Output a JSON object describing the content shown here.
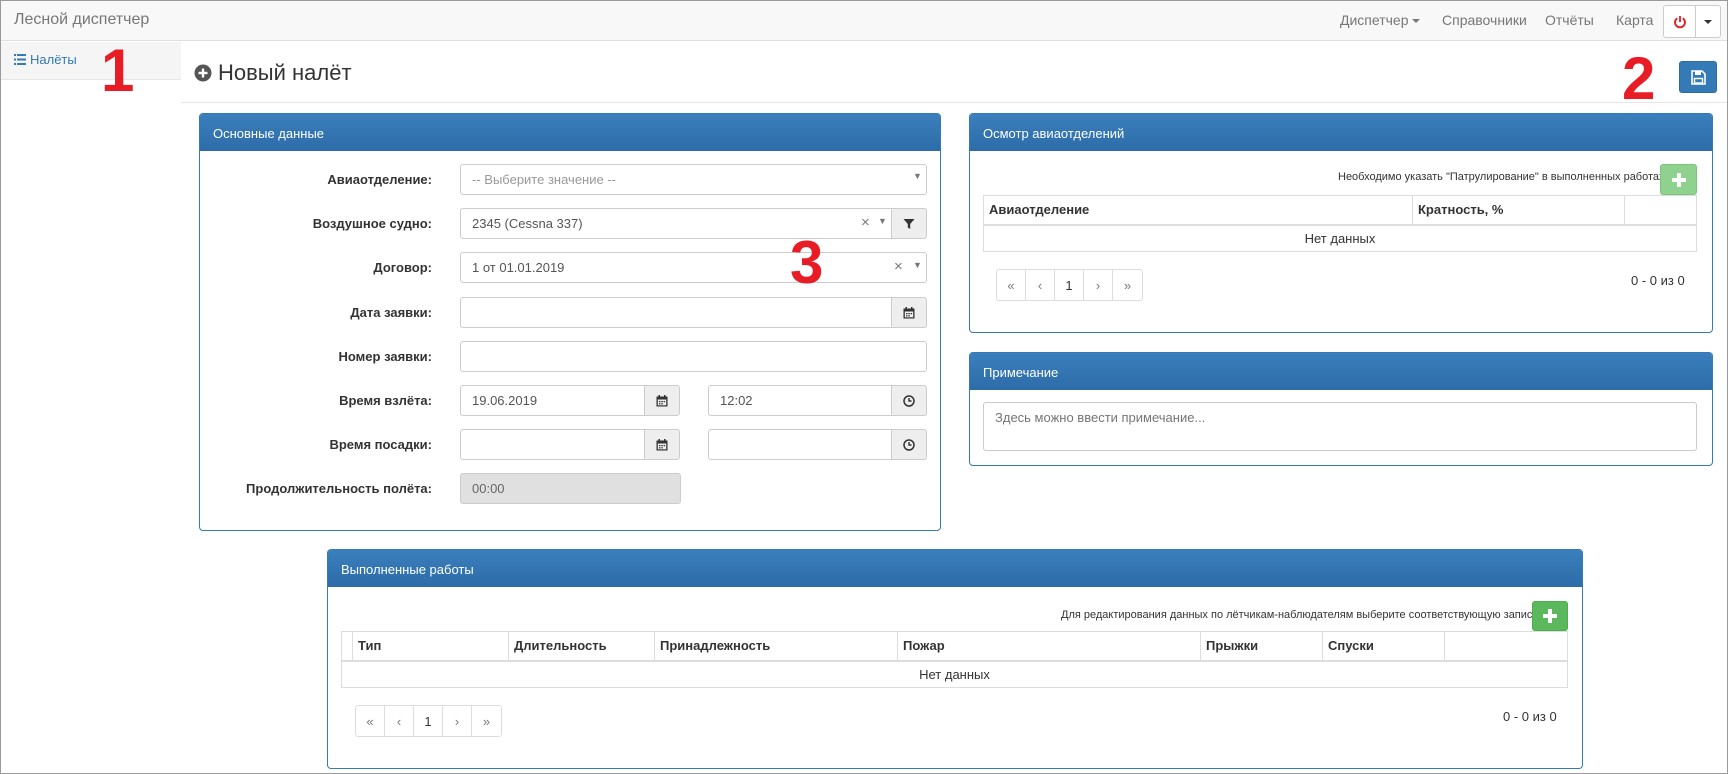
{
  "navbar": {
    "brand": "Лесной диспетчер",
    "items": [
      {
        "label": "Диспетчер"
      },
      {
        "label": "Справочники"
      },
      {
        "label": "Отчёты"
      },
      {
        "label": "Карта"
      }
    ]
  },
  "sidebar": {
    "items": [
      {
        "label": "Налёты"
      }
    ]
  },
  "page": {
    "title": "Новый налёт"
  },
  "annotations": [
    "1",
    "2",
    "3"
  ],
  "main_panel": {
    "title": "Основные данные",
    "fields": {
      "aviaotdelenie": {
        "label": "Авиаотделение:",
        "value": "-- Выберите значение --"
      },
      "aircraft": {
        "label": "Воздушное судно:",
        "value": "2345 (Cessna 337)"
      },
      "contract": {
        "label": "Договор:",
        "value": "1 от 01.01.2019"
      },
      "request_date": {
        "label": "Дата заявки:",
        "value": ""
      },
      "request_number": {
        "label": "Номер заявки:",
        "value": ""
      },
      "takeoff": {
        "label": "Время взлёта:",
        "date": "19.06.2019",
        "time": "12:02"
      },
      "landing": {
        "label": "Время посадки:",
        "date": "",
        "time": ""
      },
      "duration": {
        "label": "Продолжительность полёта:",
        "value": "00:00"
      }
    }
  },
  "inspection_panel": {
    "title": "Осмотр авиаотделений",
    "hint": "Необходимо указать \"Патрулирование\" в выполненных работах",
    "columns": [
      "Авиаотделение",
      "Кратность, %",
      ""
    ],
    "empty": "Нет данных",
    "pager": [
      "«",
      "‹",
      "1",
      "›",
      "»"
    ],
    "count": "0 - 0 из 0"
  },
  "note_panel": {
    "title": "Примечание",
    "placeholder": "Здесь можно ввести примечание..."
  },
  "works_panel": {
    "title": "Выполненные работы",
    "hint": "Для редактирования данных по лётчикам-наблюдателям выберите соответствующую запись.",
    "columns": [
      "",
      "Тип",
      "Длительность",
      "Принадлежность",
      "Пожар",
      "Прыжки",
      "Спуски",
      ""
    ],
    "empty": "Нет данных",
    "pager": [
      "«",
      "‹",
      "1",
      "›",
      "»"
    ],
    "count": "0 - 0 из 0"
  },
  "colors": {
    "primary": "#337ab7",
    "success": "#5cb85c",
    "annotation": "#e81c24"
  }
}
